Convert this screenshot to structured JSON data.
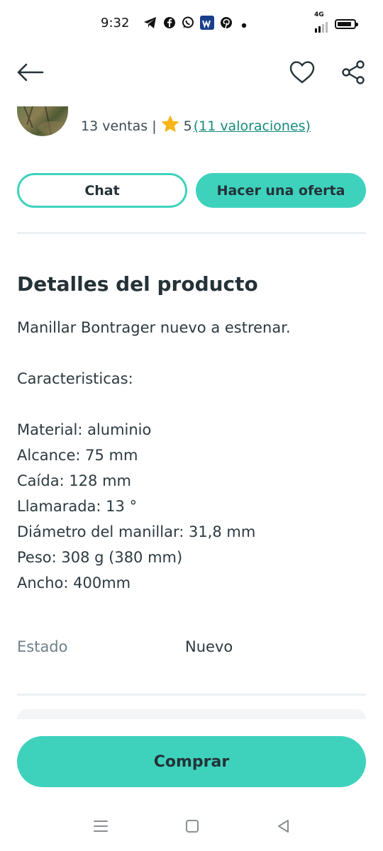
{
  "status_bar": {
    "time": "9:32",
    "network": "4G",
    "notification_icons": [
      "telegram-icon",
      "facebook-icon",
      "whatsapp-icon",
      "wallapop-icon",
      "pinterest-icon",
      "more-dot-icon"
    ],
    "battery_level_percent": 85
  },
  "header": {
    "back_icon": "arrow-left-icon",
    "favorite_icon": "heart-outline-icon",
    "share_icon": "share-icon"
  },
  "seller": {
    "sales_text": "13 ventas",
    "separator": "|",
    "rating_value": "5",
    "rating_link": "(11 valoraciones)"
  },
  "actions": {
    "chat_label": "Chat",
    "offer_label": "Hacer una oferta"
  },
  "product": {
    "section_title": "Detalles del producto",
    "description_lines": [
      "Manillar Bontrager nuevo a estrenar.",
      "",
      "Caracteristicas:",
      "",
      "Material: aluminio",
      "Alcance: 75 mm",
      "Caída: 128 mm",
      "Llamarada: 13 °",
      "Diámetro del manillar: 31,8 mm",
      "Peso: 308 g (380 mm)",
      "Ancho: 400mm"
    ],
    "state_label": "Estado",
    "state_value": "Nuevo"
  },
  "buy": {
    "label": "Comprar"
  },
  "colors": {
    "accent": "#3ed2bd",
    "text_dark": "#253238",
    "link": "#148b7a",
    "star": "#f6b619"
  }
}
